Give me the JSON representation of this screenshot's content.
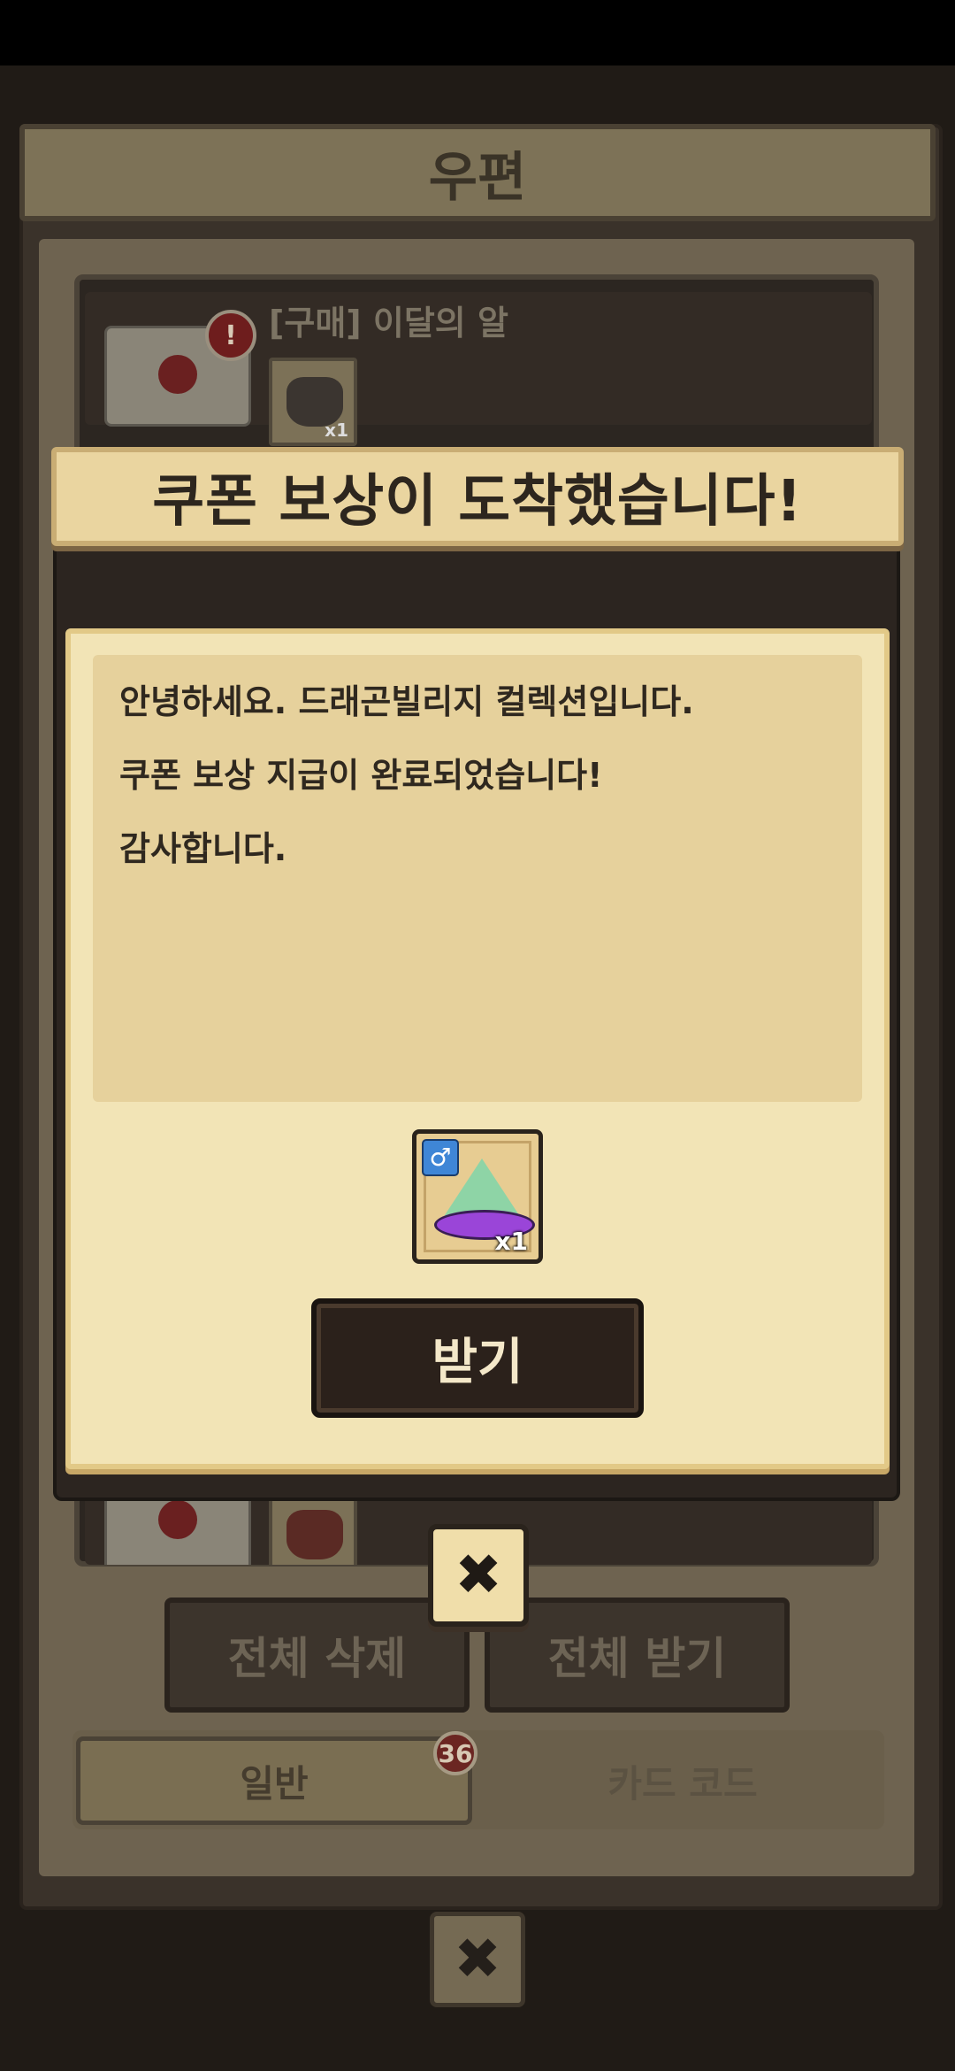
{
  "mailbox": {
    "title": "우편",
    "mail_item": {
      "title": "[구매] 이달의 알",
      "alert": "!",
      "item_qty": "x1"
    },
    "delete_all_label": "전체 삭제",
    "receive_all_label": "전체 받기",
    "tabs": [
      {
        "label": "일반",
        "badge": "36"
      },
      {
        "label": "카드 코드"
      }
    ],
    "close_symbol": "✖"
  },
  "popup": {
    "title": "쿠폰 보상이 도착했습니다!",
    "message_lines": [
      "안녕하세요. 드래곤빌리지 컬렉션입니다.",
      "쿠폰 보상 지급이 완료되었습니다!",
      "감사합니다."
    ],
    "reward": {
      "gender_symbol": "♂",
      "qty": "x1"
    },
    "receive_label": "받기",
    "close_symbol": "✖"
  }
}
